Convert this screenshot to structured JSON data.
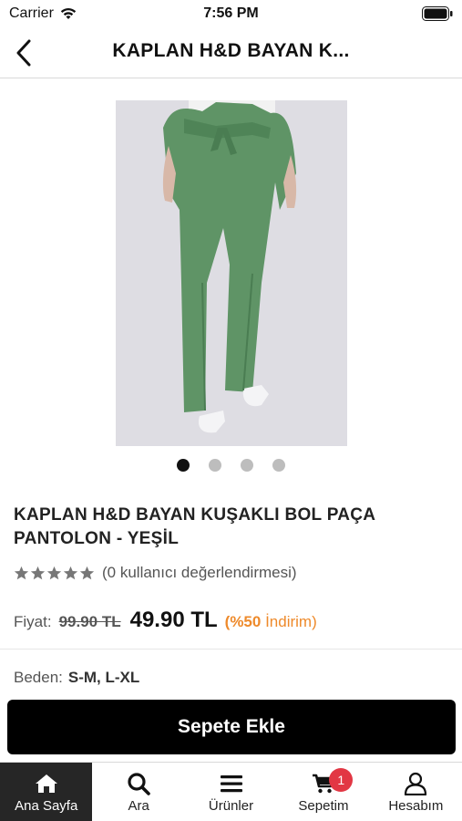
{
  "status_bar": {
    "carrier": "Carrier",
    "time": "7:56 PM"
  },
  "nav": {
    "title": "KAPLAN H&D BAYAN K..."
  },
  "product": {
    "name": "KAPLAN H&D BAYAN KUŞAKLI BOL PAÇA PANTOLON - YEŞİL",
    "image_color": "#5f9466",
    "image_count": 4,
    "active_image": 1,
    "rating_stars": 5,
    "rating_text": "(0 kullanıcı değerlendirmesi)",
    "price_label": "Fiyat:",
    "old_price": "99.90 TL",
    "new_price": "49.90 TL",
    "discount_open": "(%50",
    "discount_text": "İndirim)",
    "size_label": "Beden:",
    "size_values": "S-M, L-XL"
  },
  "add_to_cart_label": "Sepete Ekle",
  "colors": {
    "accent": "#ee8a2b",
    "badge": "#e23744",
    "primary_button": "#000000",
    "active_tab": "#262626"
  },
  "tabs": [
    {
      "label": "Ana Sayfa",
      "icon": "home-icon",
      "active": true
    },
    {
      "label": "Ara",
      "icon": "search-icon",
      "active": false
    },
    {
      "label": "Ürünler",
      "icon": "menu-icon",
      "active": false
    },
    {
      "label": "Sepetim",
      "icon": "cart-icon",
      "active": false,
      "badge": "1"
    },
    {
      "label": "Hesabım",
      "icon": "user-icon",
      "active": false
    }
  ]
}
